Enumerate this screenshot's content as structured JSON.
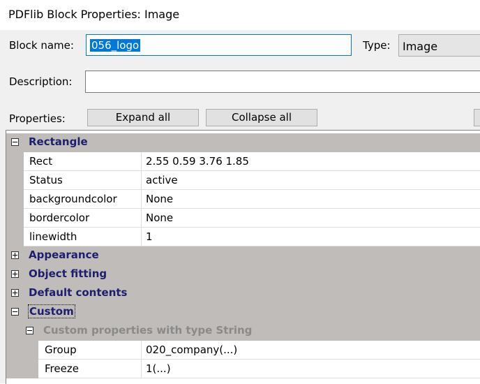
{
  "window": {
    "title": "PDFlib Block Properties: Image"
  },
  "form": {
    "block_name_label": "Block name:",
    "block_name_value": "056_logo",
    "type_label": "Type:",
    "type_value": "Image",
    "description_label": "Description:",
    "description_value": "",
    "properties_label": "Properties:",
    "expand_all": "Expand all",
    "collapse_all": "Collapse all"
  },
  "grid": {
    "rectangle": {
      "label": "Rectangle",
      "rows": [
        {
          "name": "Rect",
          "value": "2.55 0.59 3.76 1.85"
        },
        {
          "name": "Status",
          "value": "active"
        },
        {
          "name": "backgroundcolor",
          "value": "None"
        },
        {
          "name": "bordercolor",
          "value": "None"
        },
        {
          "name": "linewidth",
          "value": "1"
        }
      ]
    },
    "appearance": "Appearance",
    "object_fitting": "Object fitting",
    "default_contents": "Default contents",
    "custom": {
      "label": "Custom",
      "subgroup": "Custom properties with type String",
      "rows": [
        {
          "name": "Group",
          "value": "020_company(...)"
        },
        {
          "name": "Freeze",
          "value": "1(...)"
        }
      ]
    }
  },
  "colors": {
    "category_bg": "#bfbcb9",
    "category_text": "#1e1e6e",
    "selection": "#0078d7"
  }
}
